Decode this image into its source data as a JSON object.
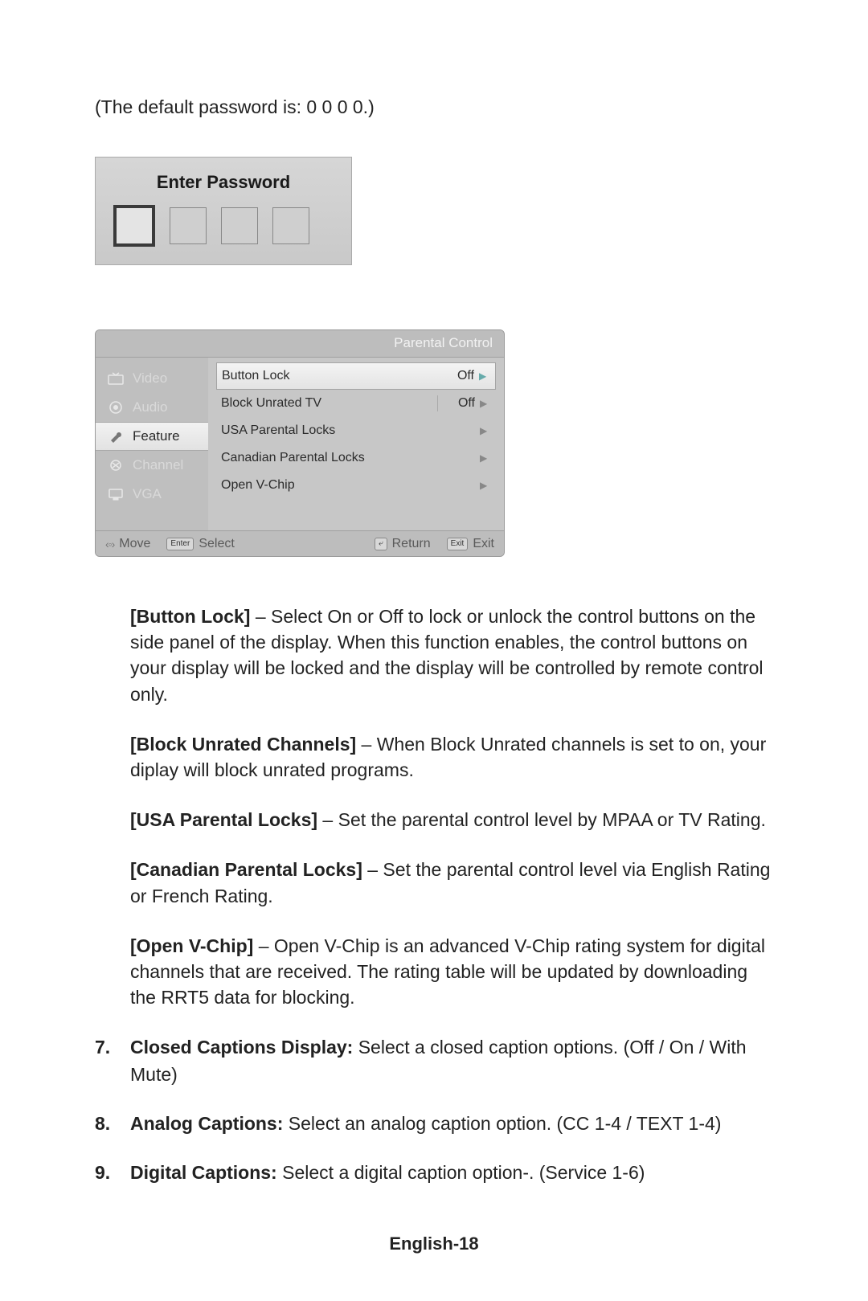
{
  "intro_text": "(The default password is: 0 0 0 0.)",
  "password_box": {
    "title": "Enter Password"
  },
  "osd": {
    "title": "Parental Control",
    "side_items": [
      {
        "label": "Video",
        "icon": "tv-icon",
        "active": false
      },
      {
        "label": "Audio",
        "icon": "speaker-icon",
        "active": false
      },
      {
        "label": "Feature",
        "icon": "wrench-icon",
        "active": true
      },
      {
        "label": "Channel",
        "icon": "antenna-icon",
        "active": false
      },
      {
        "label": "VGA",
        "icon": "monitor-icon",
        "active": false
      }
    ],
    "rows": [
      {
        "label": "Button Lock",
        "value": "Off",
        "highlight": true
      },
      {
        "label": "Block Unrated TV",
        "value": "Off",
        "highlight": false
      },
      {
        "label": "USA Parental Locks",
        "value": "",
        "highlight": false
      },
      {
        "label": "Canadian Parental Locks",
        "value": "",
        "highlight": false
      },
      {
        "label": "Open V-Chip",
        "value": "",
        "highlight": false
      }
    ],
    "footer": {
      "move": "Move",
      "select_kbd": "Enter",
      "select": "Select",
      "return_kbd": "⤶",
      "return": "Return",
      "exit_kbd": "Exit",
      "exit": "Exit"
    }
  },
  "descriptions": {
    "button_lock_title": "[Button Lock]",
    "button_lock_body": " – Select On or Off to lock or unlock the control buttons on the side panel of the display. When this function enables, the control buttons on your display will be locked and the display will be controlled by remote control only.",
    "block_unrated_title": "[Block Unrated Channels]",
    "block_unrated_body": " – When Block Unrated channels is set to on, your diplay will block unrated programs.",
    "usa_locks_title": "[USA Parental Locks]",
    "usa_locks_body": " – Set the parental control level by MPAA or TV Rating.",
    "canadian_locks_title": "[Canadian Parental Locks]",
    "canadian_locks_body": " – Set the parental control level via English Rating or French Rating.",
    "vchip_title": "[Open V-Chip]",
    "vchip_body": " – Open V-Chip is an advanced V-Chip rating system for digital channels that are received. The rating table will be updated by downloading the RRT5 data for blocking."
  },
  "numbered": [
    {
      "num": "7.",
      "bold": "Closed Captions Display:",
      "body": " Select a closed caption options. (Off / On / With Mute)"
    },
    {
      "num": "8.",
      "bold": "Analog Captions:",
      "body": " Select an analog caption option. (CC 1-4 / TEXT 1-4)"
    },
    {
      "num": "9.",
      "bold": "Digital Captions:",
      "body": " Select a digital caption option-. (Service 1-6)"
    }
  ],
  "page_footer": "English-18"
}
